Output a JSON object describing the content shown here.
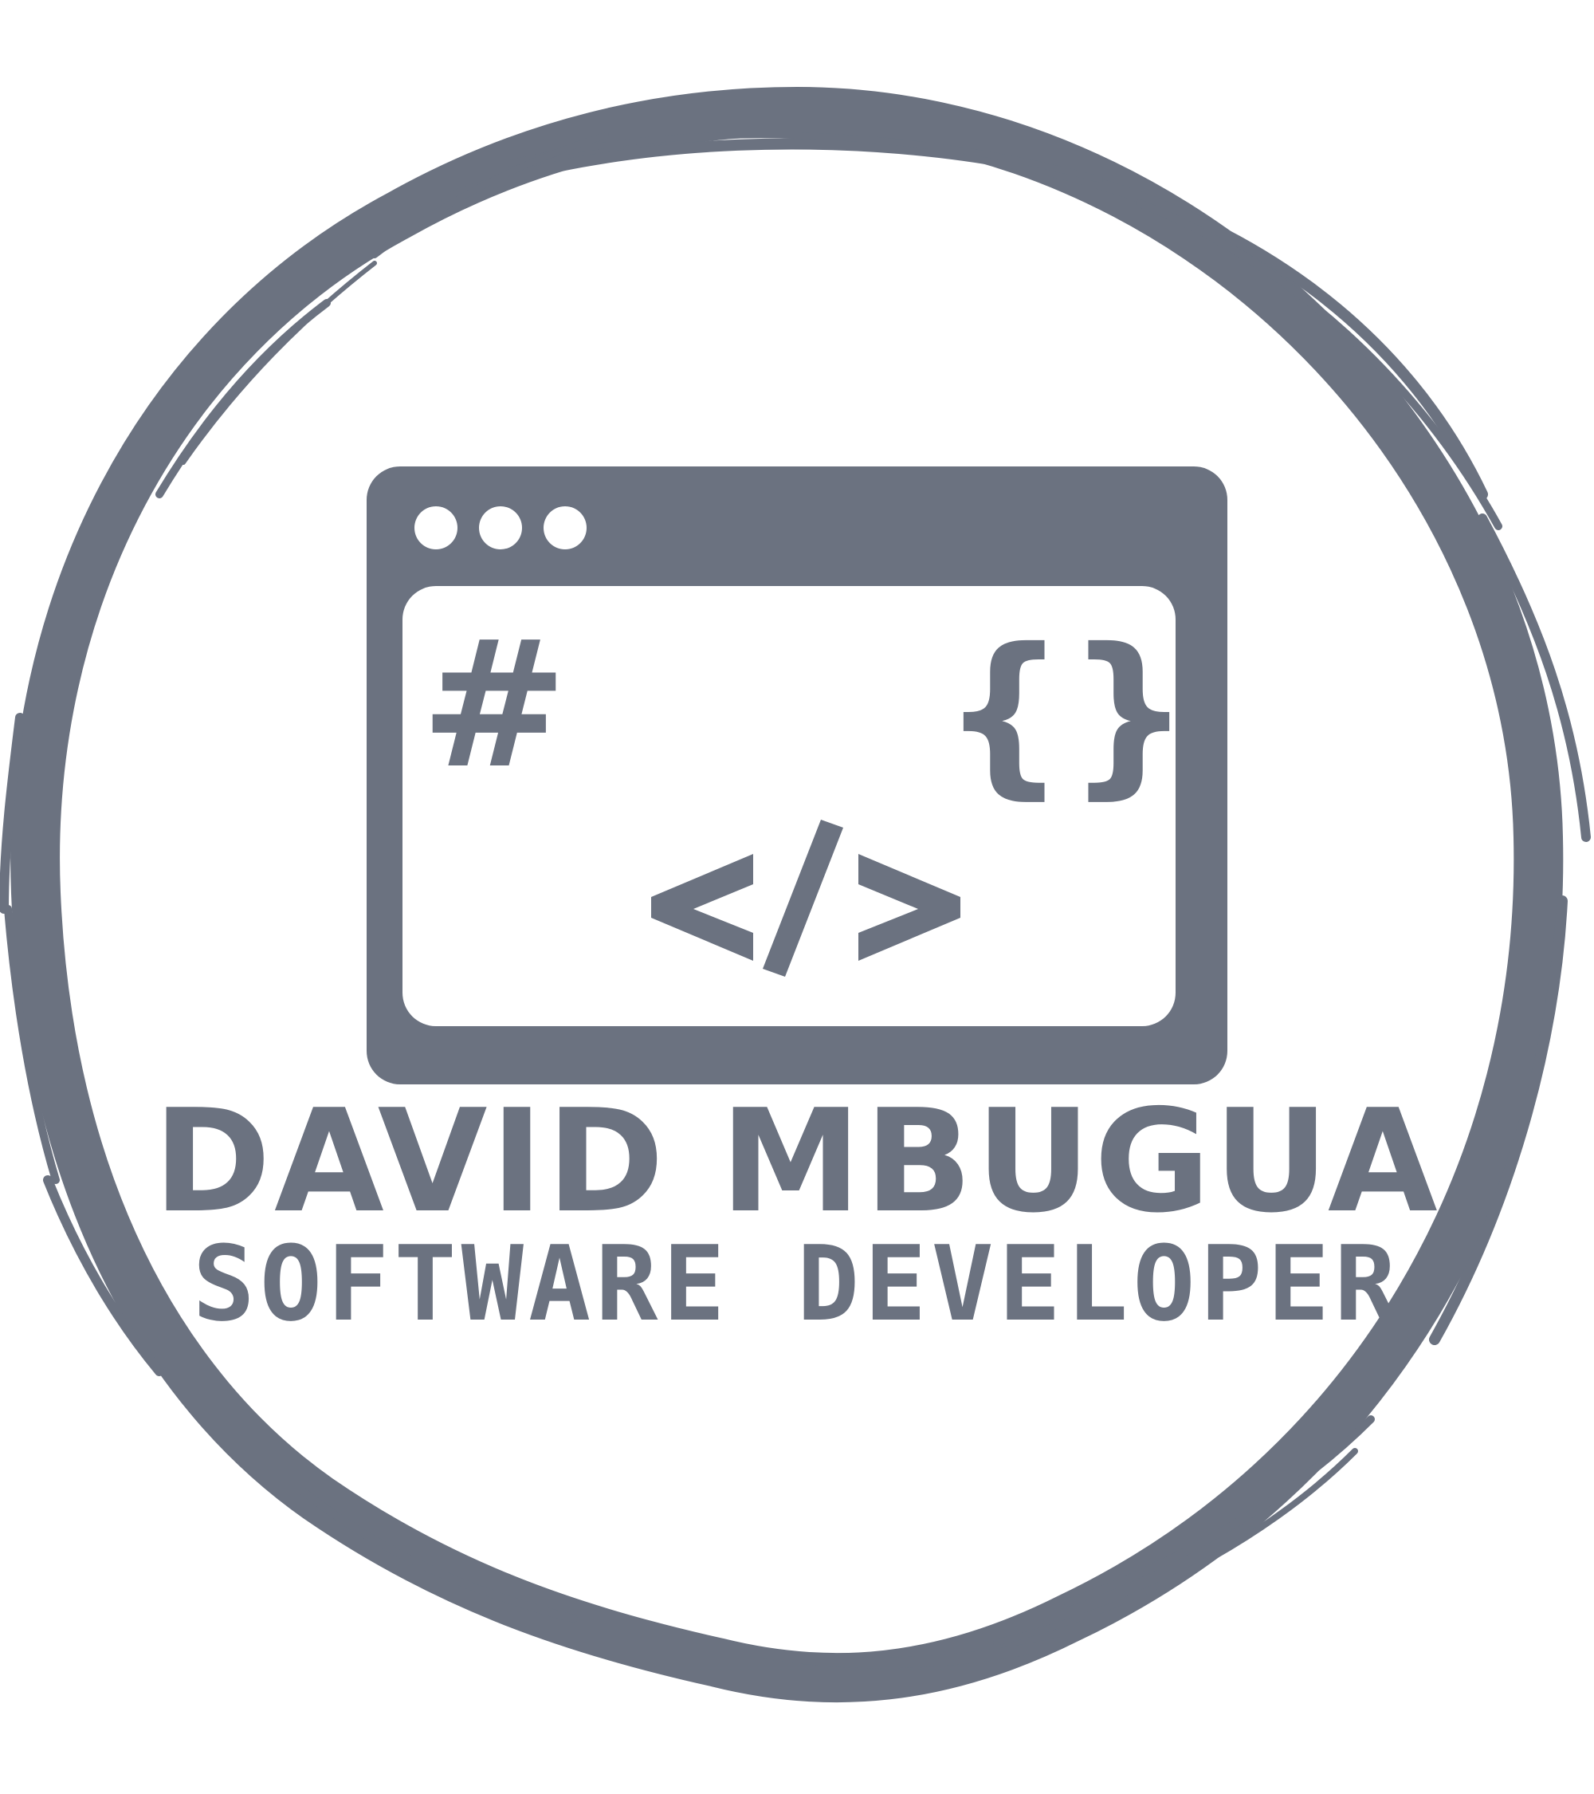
{
  "logo": {
    "name": "DAVID MBUGUA",
    "title": "SOFTWARE DEVELOPER",
    "colors": {
      "ink": "#6b7280",
      "background": "#ffffff"
    },
    "icons": [
      "brush-circle-icon",
      "browser-window-icon",
      "window-dots-icon",
      "hash-icon",
      "curly-braces-icon",
      "code-tag-icon"
    ],
    "glyphs": {
      "hash": "#",
      "braces": "{}"
    }
  }
}
